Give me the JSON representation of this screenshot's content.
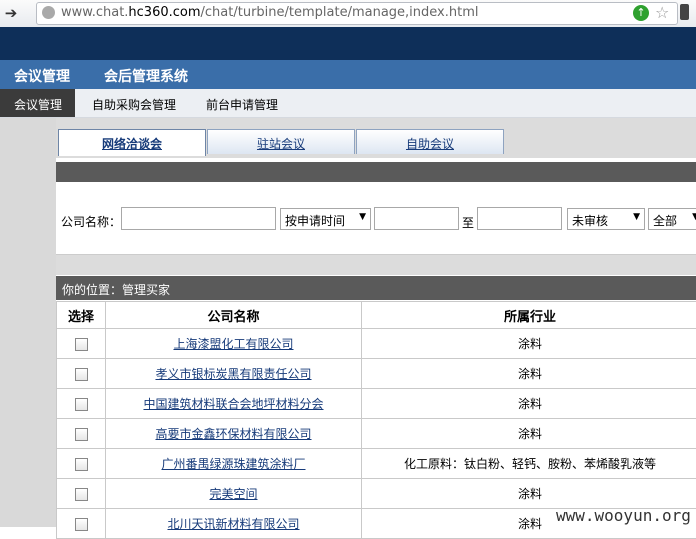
{
  "browser": {
    "url_prefix": "www.chat.",
    "url_domain": "hc360.com",
    "url_path": "/chat/turbine/template/manage,index.html"
  },
  "main_nav": [
    "会议管理",
    "会后管理系统"
  ],
  "sub_nav": [
    "会议管理",
    "自助采购会管理",
    "前台申请管理"
  ],
  "tabs": [
    "网络洽谈会",
    "驻站会议",
    "自助会议"
  ],
  "filter": {
    "company_label": "公司名称：",
    "sort_select": "按申请时间",
    "to_label": "至",
    "status_select": "未审核",
    "all_select": "全部"
  },
  "breadcrumb": "你的位置：管理买家",
  "table": {
    "headers": [
      "选择",
      "公司名称",
      "所属行业"
    ],
    "rows": [
      {
        "company": "上海漆盟化工有限公司",
        "industry": "涂料"
      },
      {
        "company": "孝义市银标炭黑有限责任公司",
        "industry": "涂料"
      },
      {
        "company": "中国建筑材料联合会地坪材料分会",
        "industry": "涂料"
      },
      {
        "company": "高要市金鑫环保材料有限公司",
        "industry": "涂料"
      },
      {
        "company": "广州番禺绿源珠建筑涂料厂",
        "industry": "化工原料：钛白粉、轻钙、胺粉、苯烯酸乳液等"
      },
      {
        "company": "完美空间",
        "industry": "涂料"
      },
      {
        "company": "北川天讯新材料有限公司",
        "industry": "涂料"
      }
    ]
  },
  "watermark": "www.wooyun.org"
}
